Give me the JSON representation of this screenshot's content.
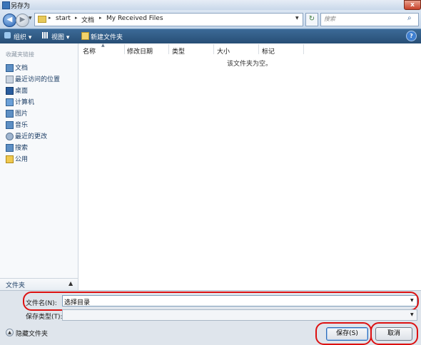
{
  "window": {
    "title": "另存为",
    "close_glyph": "x"
  },
  "nav": {
    "back_glyph": "◀",
    "forward_glyph": "▶",
    "breadcrumbs": [
      "start",
      "文档",
      "My Received Files"
    ],
    "refresh_glyph": "↻",
    "search_placeholder": "搜索"
  },
  "toolbar": {
    "organize": "组织 ▾",
    "views": "视图 ▾",
    "new_folder": "新建文件夹"
  },
  "sidebar": {
    "header": "收藏夹链接",
    "items": [
      {
        "label": "文档",
        "icon": "documents-icon"
      },
      {
        "label": "最近访问的位置",
        "icon": "recent-places-icon"
      },
      {
        "label": "桌面",
        "icon": "desktop-icon"
      },
      {
        "label": "计算机",
        "icon": "computer-icon"
      },
      {
        "label": "图片",
        "icon": "pictures-icon"
      },
      {
        "label": "音乐",
        "icon": "music-icon"
      },
      {
        "label": "最近的更改",
        "icon": "recent-changes-icon"
      },
      {
        "label": "搜索",
        "icon": "searches-icon"
      },
      {
        "label": "公用",
        "icon": "public-folder-icon"
      }
    ],
    "folders_label": "文件夹"
  },
  "filelist": {
    "columns": [
      "名称",
      "修改日期",
      "类型",
      "大小",
      "标记"
    ],
    "empty_message": "该文件夹为空。"
  },
  "form": {
    "filename_label": "文件名(N):",
    "filename_value": "选择目录",
    "filetype_label": "保存类型(T):",
    "filetype_value": "",
    "hide_folders_label": "隐藏文件夹",
    "save_label": "保存(S)",
    "cancel_label": "取消"
  },
  "colors": {
    "toolbar": "#2f5a85",
    "highlight_ring": "#dd1111"
  }
}
